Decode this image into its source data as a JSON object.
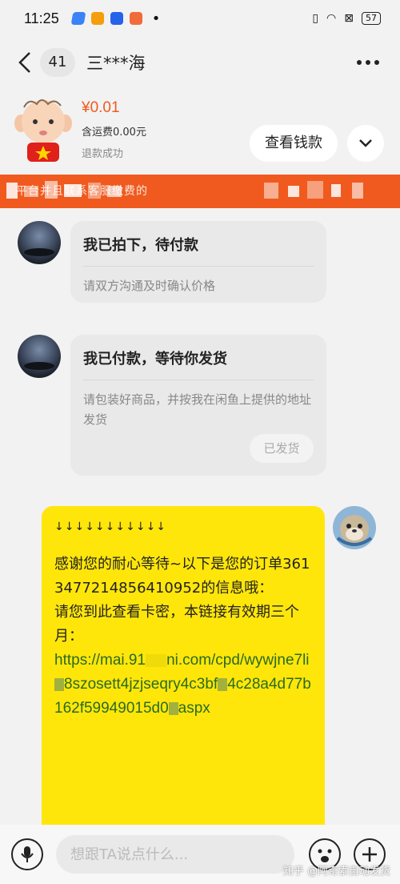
{
  "status_bar": {
    "time": "11:25",
    "battery": "57"
  },
  "header": {
    "unread_count": "41",
    "contact_name": "三***海"
  },
  "order": {
    "price": "¥0.01",
    "shipping": "含运费0.00元",
    "status": "退款成功",
    "view_money_label": "查看钱款"
  },
  "notice": {
    "text": "                 平台并且联系客服缴费的"
  },
  "messages": [
    {
      "title": "我已拍下，待付款",
      "desc": "请双方沟通及时确认价格"
    },
    {
      "title": "我已付款，等待你发货",
      "desc": "请包装好商品，并按我在闲鱼上提供的地址发货",
      "action_label": "已发货"
    }
  ],
  "my_message": {
    "arrows": "↓↓↓↓↓↓↓↓↓↓↓",
    "line1": "感谢您的耐心等待~以下是您的订单3613477214856410952的信息哦：",
    "line2": "请您到此查看卡密，本链接有效期三个月：",
    "link_a": "https://mai.91",
    "link_b": "ni.com/cpd/wywjne7li",
    "link_c": "8szosett4jzjseqry4c3bf",
    "link_d": "4c28a4d77b162f59949015d0",
    "link_e": "aspx"
  },
  "input": {
    "placeholder": "想跟TA说点什么..."
  },
  "watermark": "知乎 @阿奇索自动发货",
  "colors": {
    "accent": "#f05a1e",
    "bubble": "#ffe60a"
  }
}
